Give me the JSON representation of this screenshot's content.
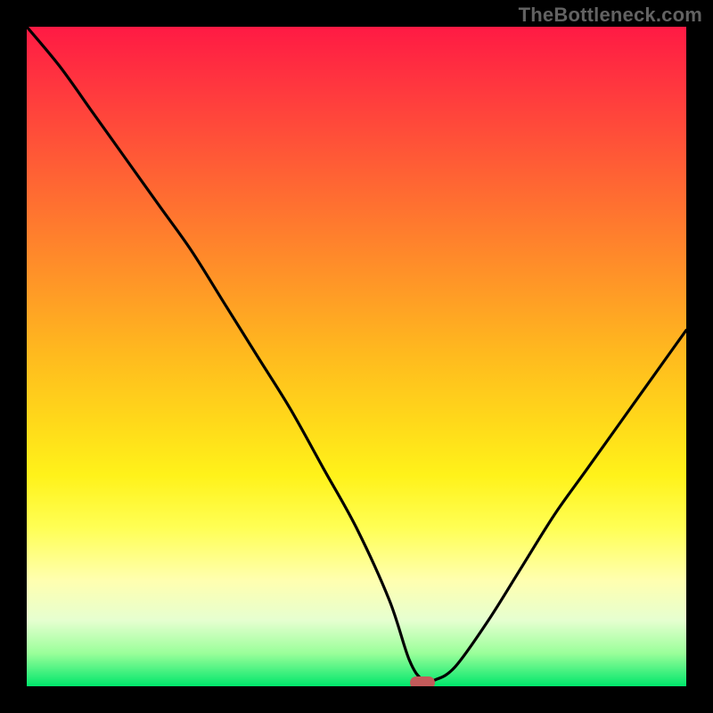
{
  "watermark": "TheBottleneck.com",
  "chart_data": {
    "type": "line",
    "title": "",
    "xlabel": "",
    "ylabel": "",
    "xlim": [
      0,
      100
    ],
    "ylim": [
      0,
      100
    ],
    "grid": false,
    "legend": false,
    "background": "rainbow-vertical",
    "series": [
      {
        "name": "bottleneck-curve",
        "x": [
          0,
          5,
          10,
          15,
          20,
          25,
          30,
          35,
          40,
          45,
          50,
          55,
          58,
          60,
          62,
          65,
          70,
          75,
          80,
          85,
          90,
          95,
          100
        ],
        "y": [
          100,
          94,
          87,
          80,
          73,
          66,
          58,
          50,
          42,
          33,
          24,
          13,
          4,
          1,
          1,
          3,
          10,
          18,
          26,
          33,
          40,
          47,
          54
        ]
      }
    ],
    "marker": {
      "x": 60,
      "y": 0.5,
      "shape": "pill",
      "color": "#c35a5a"
    }
  },
  "colors": {
    "frame": "#000000",
    "curve": "#000000",
    "watermark": "#626262",
    "marker": "#c35a5a"
  }
}
